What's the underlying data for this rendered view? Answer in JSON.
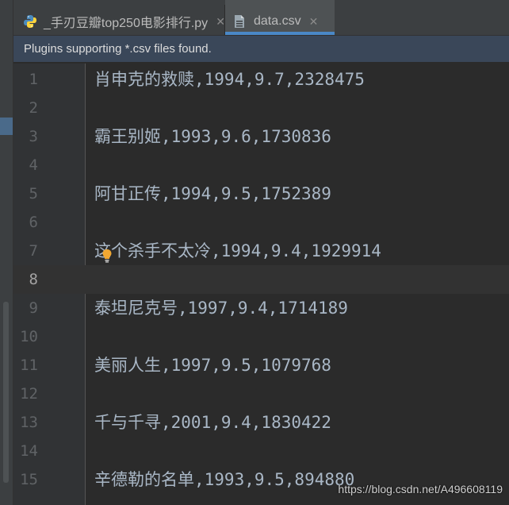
{
  "tabs": [
    {
      "label": "_手刃豆瓣top250电影排行.py",
      "icon": "python-file-icon",
      "active": false
    },
    {
      "label": "data.csv",
      "icon": "csv-file-icon",
      "active": true
    }
  ],
  "banner": {
    "text": "Plugins supporting *.csv files found."
  },
  "editor": {
    "current_line": 8,
    "lines": [
      {
        "num": "1",
        "text": "肖申克的救赎,1994,9.7,2328475"
      },
      {
        "num": "2",
        "text": ""
      },
      {
        "num": "3",
        "text": "霸王别姬,1993,9.6,1730836"
      },
      {
        "num": "4",
        "text": ""
      },
      {
        "num": "5",
        "text": "阿甘正传,1994,9.5,1752389"
      },
      {
        "num": "6",
        "text": ""
      },
      {
        "num": "7",
        "text": "这个杀手不太冷,1994,9.4,1929914"
      },
      {
        "num": "8",
        "text": ""
      },
      {
        "num": "9",
        "text": "泰坦尼克号,1997,9.4,1714189"
      },
      {
        "num": "10",
        "text": ""
      },
      {
        "num": "11",
        "text": "美丽人生,1997,9.5,1079768"
      },
      {
        "num": "12",
        "text": ""
      },
      {
        "num": "13",
        "text": "千与千寻,2001,9.4,1830422"
      },
      {
        "num": "14",
        "text": ""
      },
      {
        "num": "15",
        "text": "辛德勒的名单,1993,9.5,894880"
      }
    ]
  },
  "watermark": {
    "text": "https://blog.csdn.net/A496608119"
  },
  "colors": {
    "editor_bg": "#2b2b2b",
    "gutter_bg": "#313335",
    "text": "#a9b7c6",
    "line_number": "#606366",
    "banner_bg": "#3a4759",
    "active_tab_underline": "#4a88c7",
    "bulb": "#f0a732"
  }
}
